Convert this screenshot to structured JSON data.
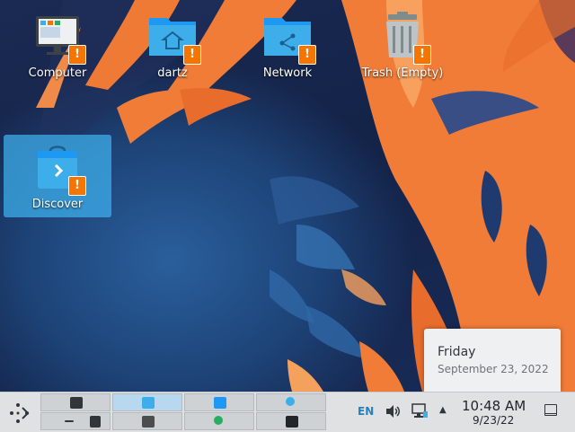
{
  "desktop": {
    "icons": [
      {
        "label": "Computer",
        "icon": "computer-monitor-icon"
      },
      {
        "label": "dartz",
        "icon": "home-folder-icon"
      },
      {
        "label": "Network",
        "icon": "network-folder-icon"
      },
      {
        "label": "Trash (Empty)",
        "icon": "trash-icon"
      },
      {
        "label": "Discover",
        "icon": "discover-store-icon",
        "selected": true
      }
    ],
    "badge_symbol": "!"
  },
  "date_popup": {
    "day": "Friday",
    "date": "September 23, 2022"
  },
  "panel": {
    "tray": {
      "language": "EN",
      "up_arrow": "▲"
    },
    "clock": {
      "time": "10:48 AM",
      "date": "9/23/22"
    }
  },
  "colors": {
    "accent": "#3daee9",
    "badge": "#f67400",
    "wallpaper_orange": "#f07c38",
    "wallpaper_blue": "#1d4377",
    "panel_bg": "#dfe1e3"
  }
}
